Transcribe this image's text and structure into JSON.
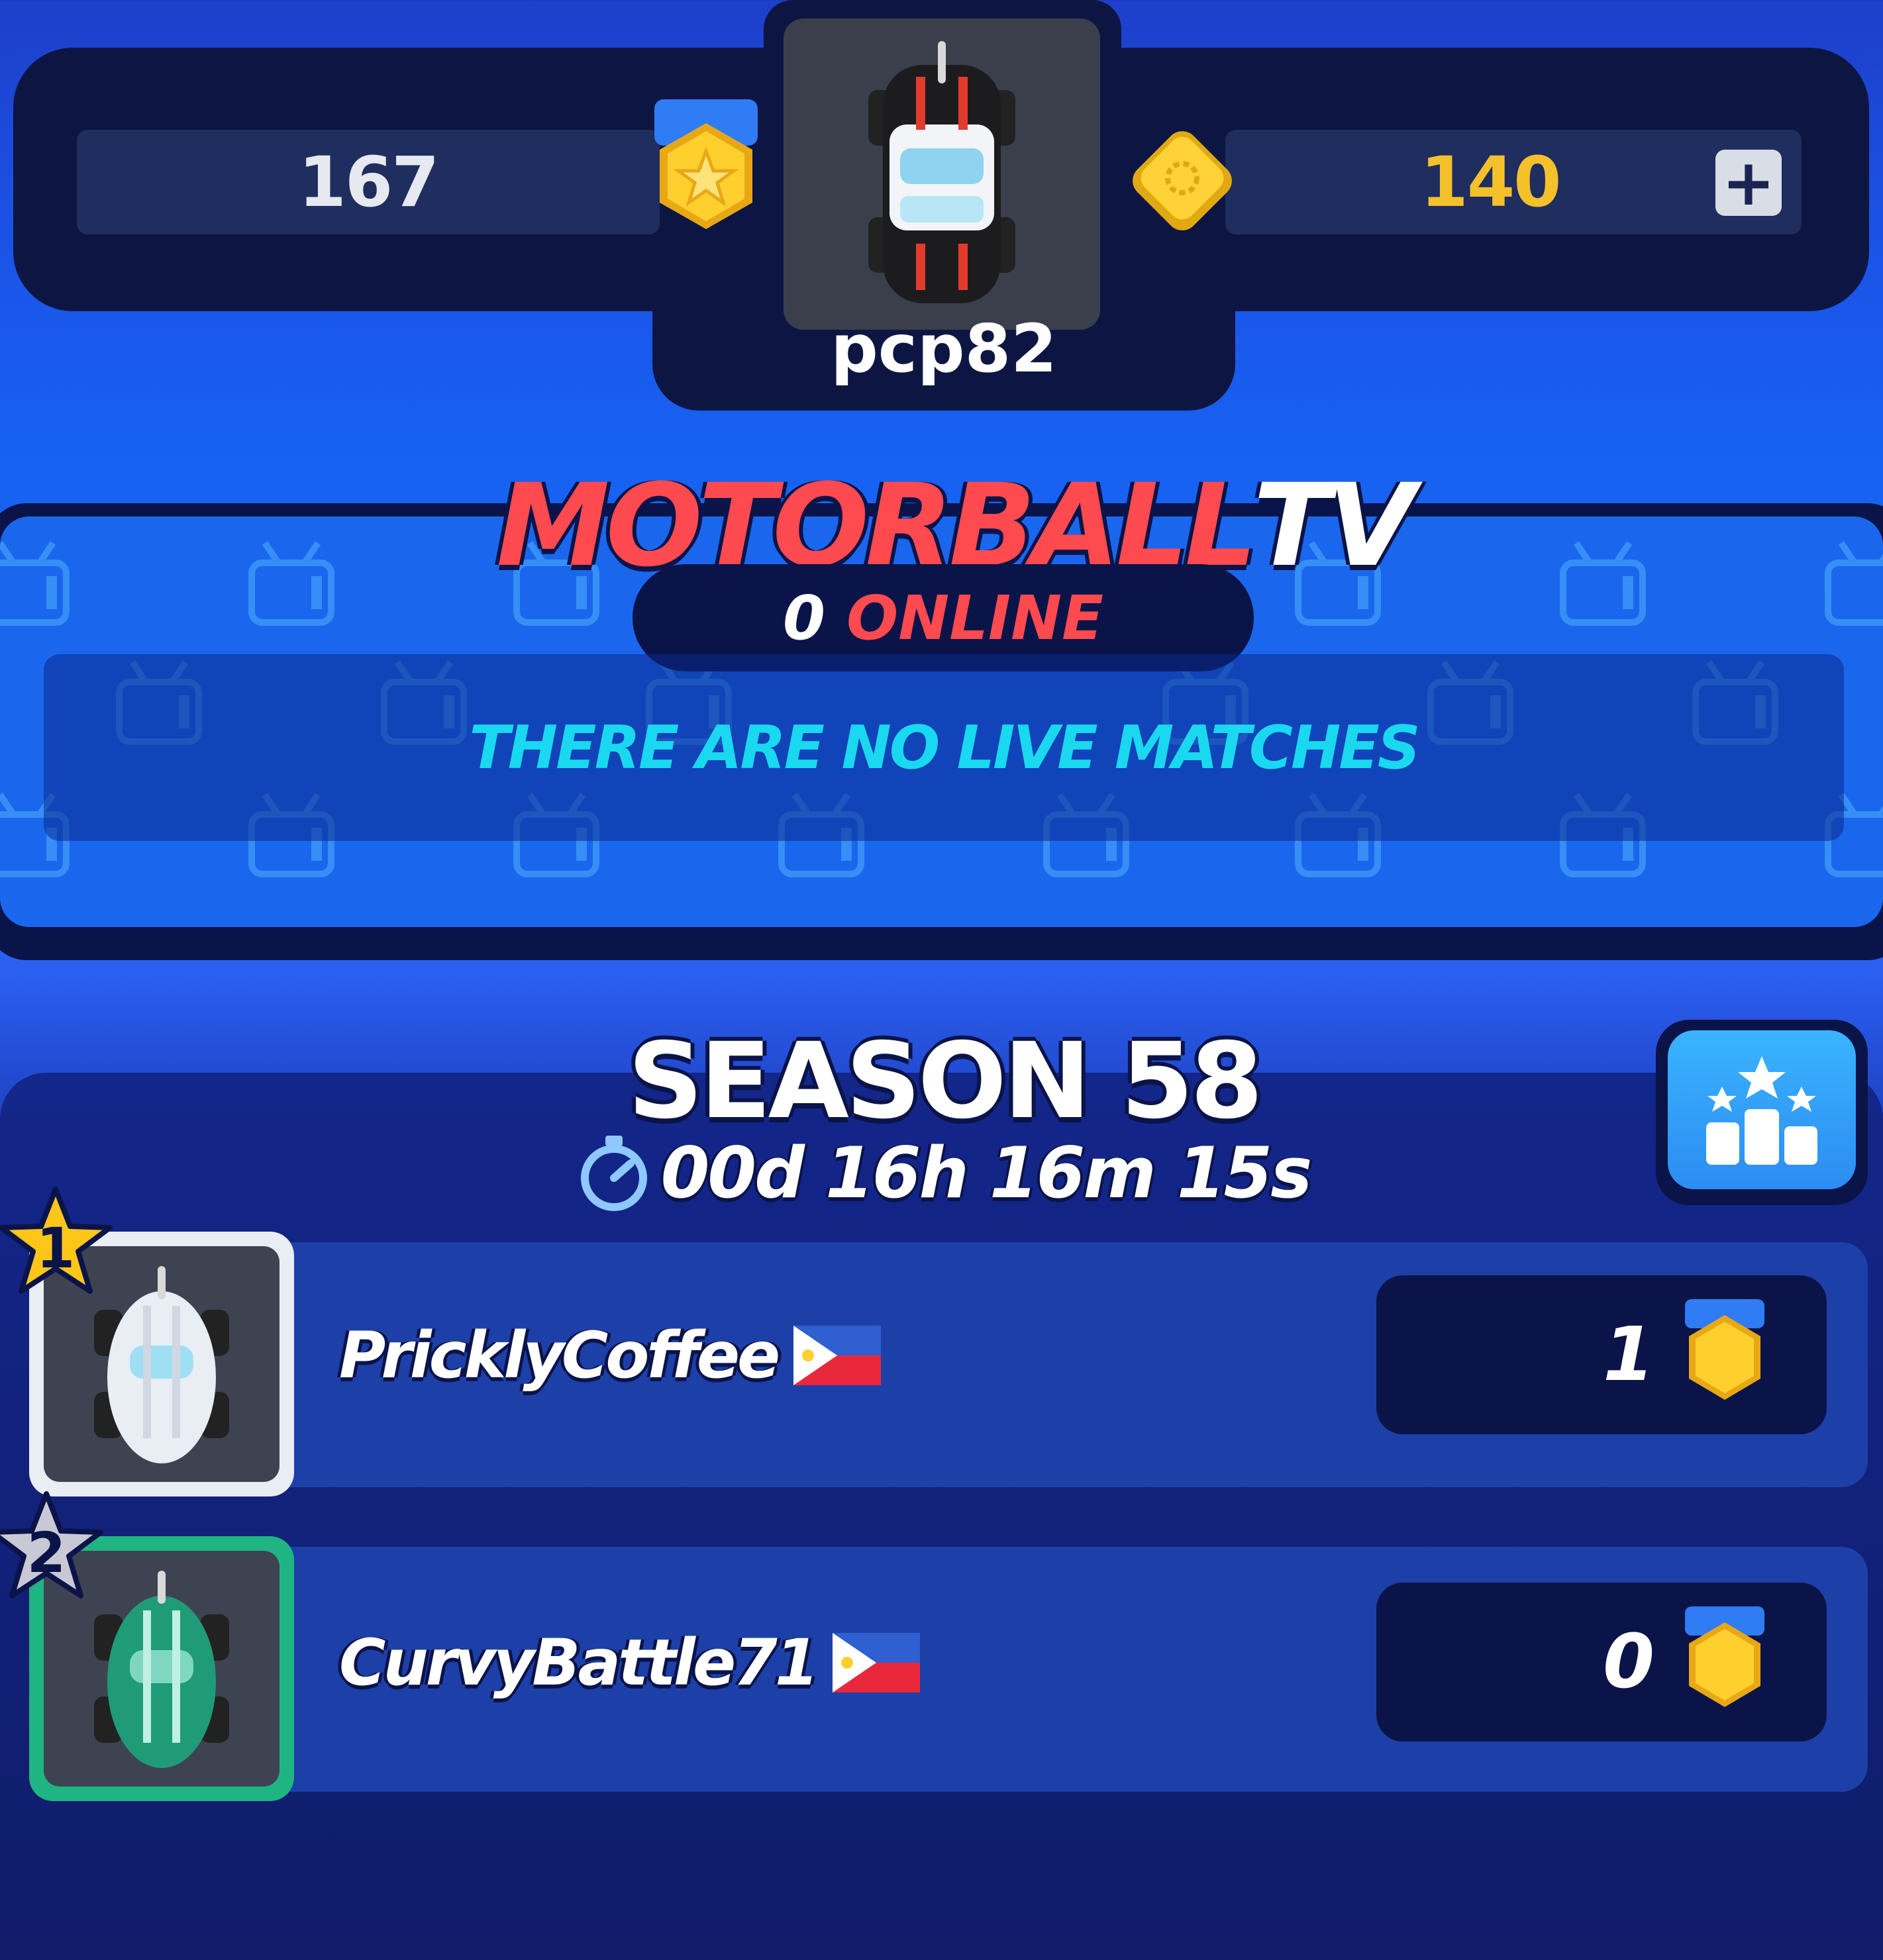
{
  "header": {
    "trophies": "167",
    "coins": "140",
    "add_coins_symbol": "+",
    "username": "pcp82",
    "icons": {
      "trophy": "gold-medal-star-icon",
      "coin": "gold-diamond-coin-icon",
      "add": "plus-icon",
      "avatar": "black-white-car-icon"
    }
  },
  "tv": {
    "title_brand": "MOTORBALL",
    "title_suffix": "TV",
    "online_count": "0",
    "online_label": "ONLINE",
    "empty_message": "THERE ARE NO LIVE MATCHES"
  },
  "season": {
    "title": "SEASON 58",
    "countdown": "00d 16h 16m 15s",
    "icons": {
      "timer": "stopwatch-icon",
      "leaderboard": "podium-icon"
    }
  },
  "leaderboard": [
    {
      "rank": "1",
      "name": "PricklyCoffee",
      "country_flag": "philippines-flag-icon",
      "score": "1",
      "car": "white-car-icon",
      "badge_color": "#ffc61a",
      "frame_color": "#e9edf4"
    },
    {
      "rank": "2",
      "name": "CurvyBattle71",
      "country_flag": "philippines-flag-icon",
      "score": "0",
      "car": "green-car-icon",
      "badge_color": "#c9c9d6",
      "frame_color": "#1fb583"
    }
  ],
  "colors": {
    "accent_red": "#ff4a4f",
    "cyan_text": "#19d8f0",
    "coin_gold": "#f4c12b",
    "panel_navy": "#0b1449"
  }
}
